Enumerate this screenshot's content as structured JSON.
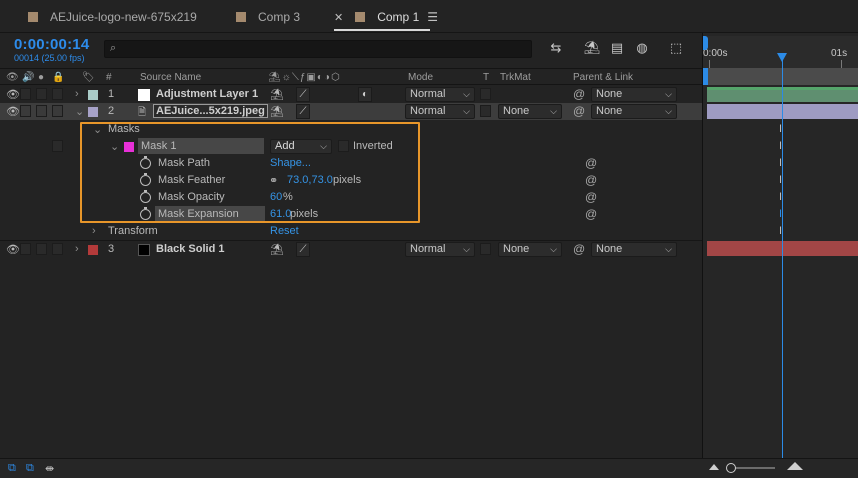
{
  "tabs": [
    {
      "label": "AEJuice-logo-new-675x219",
      "color": "#a48a6e"
    },
    {
      "label": "Comp 3",
      "color": "#a48a6e"
    },
    {
      "label": "Comp 1",
      "color": "#a48a6e",
      "active": true
    }
  ],
  "header": {
    "timecode": "0:00:00:14",
    "fps": "00014 (25.00 fps)",
    "search_icon": "⌕",
    "search_placeholder": ""
  },
  "columns": {
    "num": "#",
    "source_name": "Source Name",
    "mode": "Mode",
    "t": "T",
    "trkmat": "TrkMat",
    "parent": "Parent & Link"
  },
  "layers": [
    {
      "num": "1",
      "name": "Adjustment Layer 1",
      "label_color": "#a9cbc7",
      "mode": "Normal",
      "trkmat": "",
      "parent": "None"
    },
    {
      "num": "2",
      "name": "AEJuice...5x219.jpeg",
      "label_color": "#a7a2c8",
      "mode": "Normal",
      "trkmat": "None",
      "parent": "None"
    },
    {
      "num": "3",
      "name": "Black Solid 1",
      "label_color": "#b33a3a",
      "mode": "Normal",
      "trkmat": "None",
      "parent": "None"
    }
  ],
  "masks": {
    "group_label": "Masks",
    "mask_name": "Mask 1",
    "mask_color": "#e830d8",
    "mask_mode": "Add",
    "inverted_label": "Inverted",
    "properties": [
      {
        "name": "Mask Path",
        "value": "Shape...",
        "unit": ""
      },
      {
        "name": "Mask Feather",
        "value": "73.0,73.0",
        "unit": " pixels"
      },
      {
        "name": "Mask Opacity",
        "value": "60",
        "unit": "%"
      },
      {
        "name": "Mask Expansion",
        "value": "61.0",
        "unit": " pixels"
      }
    ]
  },
  "transform": {
    "label": "Transform",
    "reset": "Reset"
  },
  "timeline": {
    "ruler_start": "0:00s",
    "ruler_end": "01s",
    "bar_colors": [
      "#55a56b",
      "#a7a2c8",
      "#a24646"
    ]
  }
}
